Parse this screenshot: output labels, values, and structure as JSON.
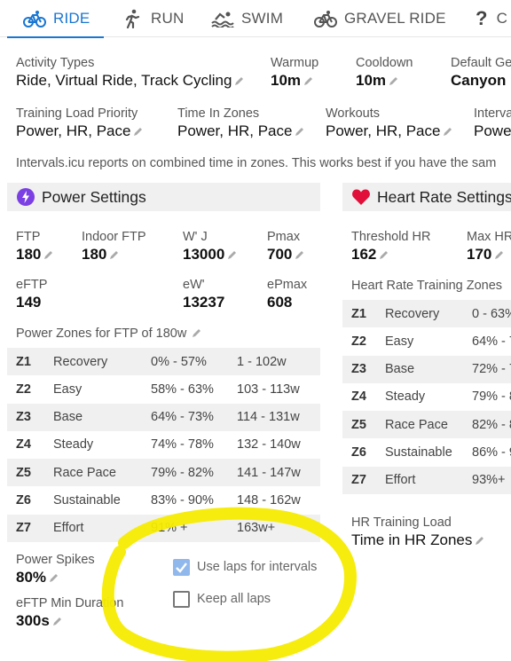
{
  "tabs": [
    {
      "label": "RIDE",
      "icon": "bike-icon",
      "active": true
    },
    {
      "label": "RUN",
      "icon": "run-icon"
    },
    {
      "label": "SWIM",
      "icon": "swim-icon"
    },
    {
      "label": "GRAVEL RIDE",
      "icon": "bike-icon"
    },
    {
      "label": "C",
      "icon": "question-icon"
    }
  ],
  "general": {
    "activity_types_label": "Activity Types",
    "activity_types_value": "Ride, Virtual Ride, Track Cycling",
    "warmup_label": "Warmup",
    "warmup_value": "10m",
    "cooldown_label": "Cooldown",
    "cooldown_value": "10m",
    "default_gear_label": "Default Ge",
    "default_gear_value": "Canyon E",
    "training_load_priority_label": "Training Load Priority",
    "training_load_priority_value": "Power, HR, Pace",
    "time_in_zones_label": "Time In Zones",
    "time_in_zones_value": "Power, HR, Pace",
    "workouts_label": "Workouts",
    "workouts_value": "Power, HR, Pace",
    "intervals_label": "Interva",
    "intervals_value": "Powe",
    "note": "Intervals.icu reports on combined time in zones. This works best if you have the sam"
  },
  "power": {
    "title": "Power Settings",
    "ftp_label": "FTP",
    "ftp_value": "180",
    "indoor_ftp_label": "Indoor FTP",
    "indoor_ftp_value": "180",
    "wj_label": "W' J",
    "wj_value": "13000",
    "pmax_label": "Pmax",
    "pmax_value": "700",
    "eftp_label": "eFTP",
    "eftp_value": "149",
    "ew_label": "eW'",
    "ew_value": "13237",
    "epmax_label": "ePmax",
    "epmax_value": "608",
    "zones_title": "Power Zones for FTP of 180w",
    "zones": [
      {
        "id": "Z1",
        "name": "Recovery",
        "pct": "0% - 57%",
        "watts": "1 - 102w"
      },
      {
        "id": "Z2",
        "name": "Easy",
        "pct": "58% - 63%",
        "watts": "103 - 113w"
      },
      {
        "id": "Z3",
        "name": "Base",
        "pct": "64% - 73%",
        "watts": "114 - 131w"
      },
      {
        "id": "Z4",
        "name": "Steady",
        "pct": "74% - 78%",
        "watts": "132 - 140w"
      },
      {
        "id": "Z5",
        "name": "Race Pace",
        "pct": "79% - 82%",
        "watts": "141 - 147w"
      },
      {
        "id": "Z6",
        "name": "Sustainable",
        "pct": "83% - 90%",
        "watts": "148 - 162w"
      },
      {
        "id": "Z7",
        "name": "Effort",
        "pct": "91% +",
        "watts": "163w+"
      }
    ],
    "spikes_label": "Power Spikes",
    "spikes_value": "80%",
    "eftp_min_label": "eFTP Min Duration",
    "eftp_min_value": "300s",
    "use_laps_label": "Use laps for intervals",
    "use_laps_checked": true,
    "keep_laps_label": "Keep all laps",
    "keep_laps_checked": false
  },
  "hr": {
    "title": "Heart Rate Settings",
    "threshold_label": "Threshold HR",
    "threshold_value": "162",
    "max_label": "Max HR",
    "max_value": "170",
    "zones_title": "Heart Rate Training Zones",
    "zones": [
      {
        "id": "Z1",
        "name": "Recovery",
        "pct": "0 - 63%"
      },
      {
        "id": "Z2",
        "name": "Easy",
        "pct": "64% - 7"
      },
      {
        "id": "Z3",
        "name": "Base",
        "pct": "72% - 7"
      },
      {
        "id": "Z4",
        "name": "Steady",
        "pct": "79% - 8"
      },
      {
        "id": "Z5",
        "name": "Race Pace",
        "pct": "82% - 8"
      },
      {
        "id": "Z6",
        "name": "Sustainable",
        "pct": "86% - 9"
      },
      {
        "id": "Z7",
        "name": "Effort",
        "pct": "93%+"
      }
    ],
    "load_label": "HR Training Load",
    "load_value": "Time in HR Zones"
  },
  "colors": {
    "accent": "#1976d2",
    "power_icon": "#7b3fe4",
    "heart_icon": "#e0103a",
    "highlight": "#f5eb00",
    "shade": "#f0f0f0"
  }
}
